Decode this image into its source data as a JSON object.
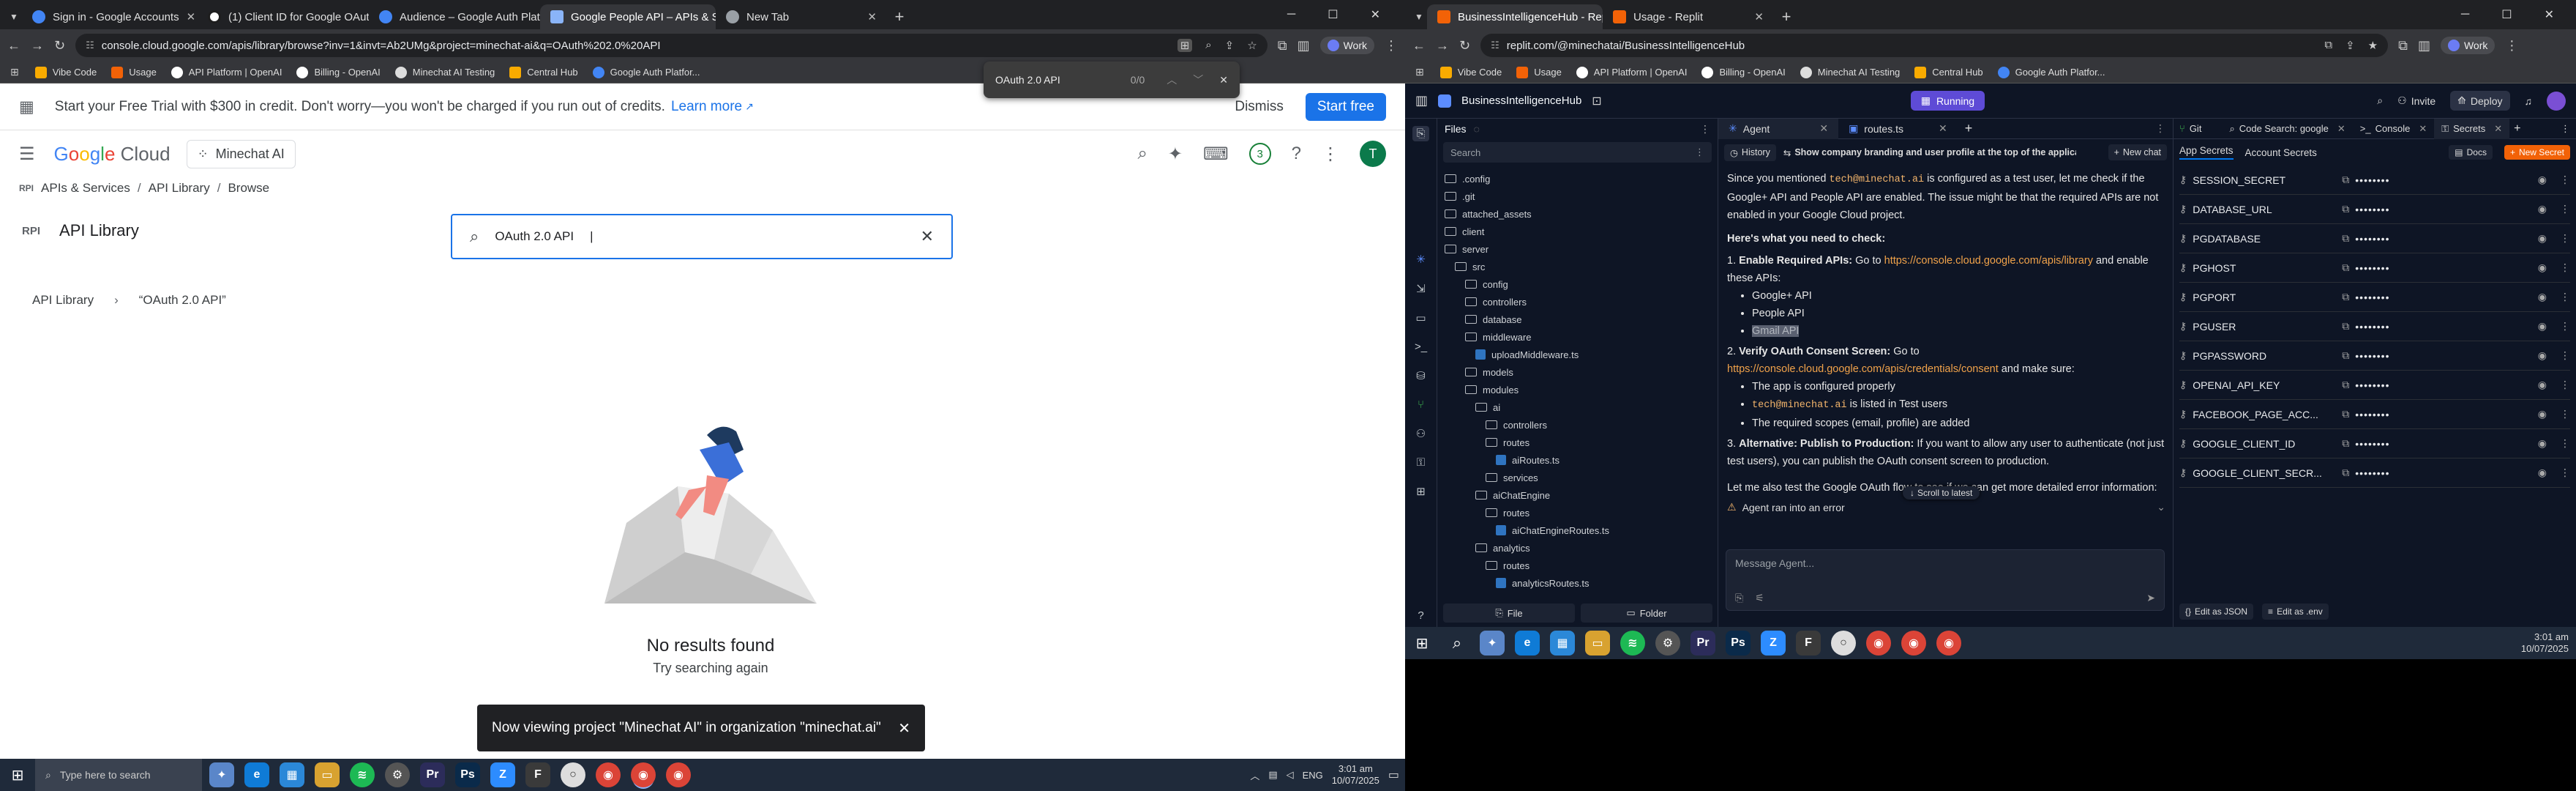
{
  "left_browser": {
    "tabs": [
      {
        "label": "Sign in - Google Accounts",
        "color": "#4285f4"
      },
      {
        "label": "(1) Client ID for Google OAuth ·",
        "color": "#1e1e1e"
      },
      {
        "label": "Audience – Google Auth Platfo",
        "color": "#4285f4"
      },
      {
        "label": "Google People API – APIs & Se",
        "color": "#8ab4f8"
      },
      {
        "label": "New Tab",
        "color": "#9aa0a6"
      }
    ],
    "url": "console.cloud.google.com/apis/library/browse?inv=1&invt=Ab2UMg&project=minechat-ai&q=OAuth%202.0%20API",
    "profile": "Work",
    "bookmarks": [
      "Vibe Code",
      "Usage",
      "API Platform | OpenAI",
      "Billing - OpenAI",
      "Minechat AI Testing",
      "Central Hub",
      "Google Auth Platfor..."
    ],
    "find": {
      "query": "OAuth 2.0 API",
      "count": "0/0"
    }
  },
  "gcp": {
    "banner_text": "Start your Free Trial with $300 in credit. Don't worry—you won't be charged if you run out of credits.",
    "banner_link": "Learn more",
    "dismiss": "Dismiss",
    "start_free": "Start free",
    "logo": "Google Cloud",
    "project": "Minechat AI",
    "notif_count": "3",
    "avatar": "T",
    "breadcrumb": [
      "APIs & Services",
      "API Library",
      "Browse"
    ],
    "page_title": "API Library",
    "search_value": "OAuth 2.0 API",
    "crumb2": [
      "API Library",
      "“OAuth 2.0 API”"
    ],
    "no_results": "No results found",
    "try_again": "Try searching again",
    "toast": "Now viewing project \"Minechat AI\" in organization \"minechat.ai\""
  },
  "taskbar_left": {
    "search_placeholder": "Type here to search",
    "lang": "ENG",
    "time": "3:01 am",
    "date": "10/07/2025"
  },
  "right_browser": {
    "tabs": [
      {
        "label": "BusinessIntelligenceHub - Repli",
        "color": "#f26207"
      },
      {
        "label": "Usage - Replit",
        "color": "#f26207"
      }
    ],
    "url": "replit.com/@minechatai/BusinessIntelligenceHub",
    "profile": "Work",
    "bookmarks": [
      "Vibe Code",
      "Usage",
      "API Platform | OpenAI",
      "Billing - OpenAI",
      "Minechat AI Testing",
      "Central Hub",
      "Google Auth Platfor..."
    ]
  },
  "replit": {
    "project": "BusinessIntelligenceHub",
    "status": "Running",
    "invite": "Invite",
    "deploy": "Deploy",
    "files_title": "Files",
    "search": "Search",
    "tree": [
      {
        "n": ".config",
        "d": 0,
        "t": "f"
      },
      {
        "n": ".git",
        "d": 0,
        "t": "f"
      },
      {
        "n": "attached_assets",
        "d": 0,
        "t": "f"
      },
      {
        "n": "client",
        "d": 0,
        "t": "f"
      },
      {
        "n": "server",
        "d": 0,
        "t": "f"
      },
      {
        "n": "src",
        "d": 1,
        "t": "f"
      },
      {
        "n": "config",
        "d": 2,
        "t": "f"
      },
      {
        "n": "controllers",
        "d": 2,
        "t": "f"
      },
      {
        "n": "database",
        "d": 2,
        "t": "f"
      },
      {
        "n": "middleware",
        "d": 2,
        "t": "f"
      },
      {
        "n": "uploadMiddleware.ts",
        "d": 3,
        "t": "ts"
      },
      {
        "n": "models",
        "d": 2,
        "t": "f"
      },
      {
        "n": "modules",
        "d": 2,
        "t": "f"
      },
      {
        "n": "ai",
        "d": 3,
        "t": "f"
      },
      {
        "n": "controllers",
        "d": 4,
        "t": "f"
      },
      {
        "n": "routes",
        "d": 4,
        "t": "f"
      },
      {
        "n": "aiRoutes.ts",
        "d": 5,
        "t": "ts"
      },
      {
        "n": "services",
        "d": 4,
        "t": "f"
      },
      {
        "n": "aiChatEngine",
        "d": 3,
        "t": "f"
      },
      {
        "n": "routes",
        "d": 4,
        "t": "f"
      },
      {
        "n": "aiChatEngineRoutes.ts",
        "d": 5,
        "t": "ts"
      },
      {
        "n": "analytics",
        "d": 3,
        "t": "f"
      },
      {
        "n": "routes",
        "d": 4,
        "t": "f"
      },
      {
        "n": "analyticsRoutes.ts",
        "d": 5,
        "t": "ts"
      }
    ],
    "file_btn": "File",
    "folder_btn": "Folder",
    "agent_tab": "Agent",
    "routes_tab": "routes.ts",
    "history": "History",
    "task": "Show company branding and user profile at the top of the application",
    "new_chat": "New chat",
    "msg1_a": "Since you mentioned ",
    "email": "tech@minechat.ai",
    "msg1_b": " is configured as a test user, let me check if the Google+ API and People API are enabled. The issue might be that the required APIs are not enabled in your Google Cloud project.",
    "need": "Here's what you need to check:",
    "s1_title": "Enable Required APIs:",
    "s1_goto": " Go to ",
    "s1_link": "https://console.cloud.google.com/apis/library",
    "s1_tail": " and enable these APIs:",
    "s1_items": [
      "Google+ API",
      "People API",
      "Gmail API"
    ],
    "s2_title": "Verify OAuth Consent Screen:",
    "s2_goto": " Go to ",
    "s2_link": "https://console.cloud.google.com/apis/credentials/consent",
    "s2_tail": " and make sure:",
    "s2_items": [
      "The app is configured properly",
      "is listed in Test users",
      "The required scopes (email, profile) are added"
    ],
    "s3_title": "Alternative: Publish to Production:",
    "s3_text": " If you want to allow any user to authenticate (not just test users), you can publish the OAuth consent screen to production.",
    "last": "Let me also test the Google OAuth flow to see if we can get more detailed error information:",
    "scroll": "Scroll to latest",
    "error": "Agent ran into an error",
    "placeholder": "Message Agent...",
    "right_tabs": [
      "Git",
      "Code Search: google",
      "Console",
      "Secrets"
    ],
    "docs": "Docs",
    "new_secret": "New Secret",
    "app_secrets": "App Secrets",
    "account_secrets": "Account Secrets",
    "secrets": [
      "SESSION_SECRET",
      "DATABASE_URL",
      "PGDATABASE",
      "PGHOST",
      "PGPORT",
      "PGUSER",
      "PGPASSWORD",
      "OPENAI_API_KEY",
      "FACEBOOK_PAGE_ACC...",
      "GOOGLE_CLIENT_ID",
      "GOOGLE_CLIENT_SECR..."
    ],
    "masked": "••••••••",
    "edit_json": "Edit as JSON",
    "edit_env": "Edit as .env"
  },
  "taskbar_right": {
    "time": "3:01 am",
    "date": "10/07/2025"
  }
}
